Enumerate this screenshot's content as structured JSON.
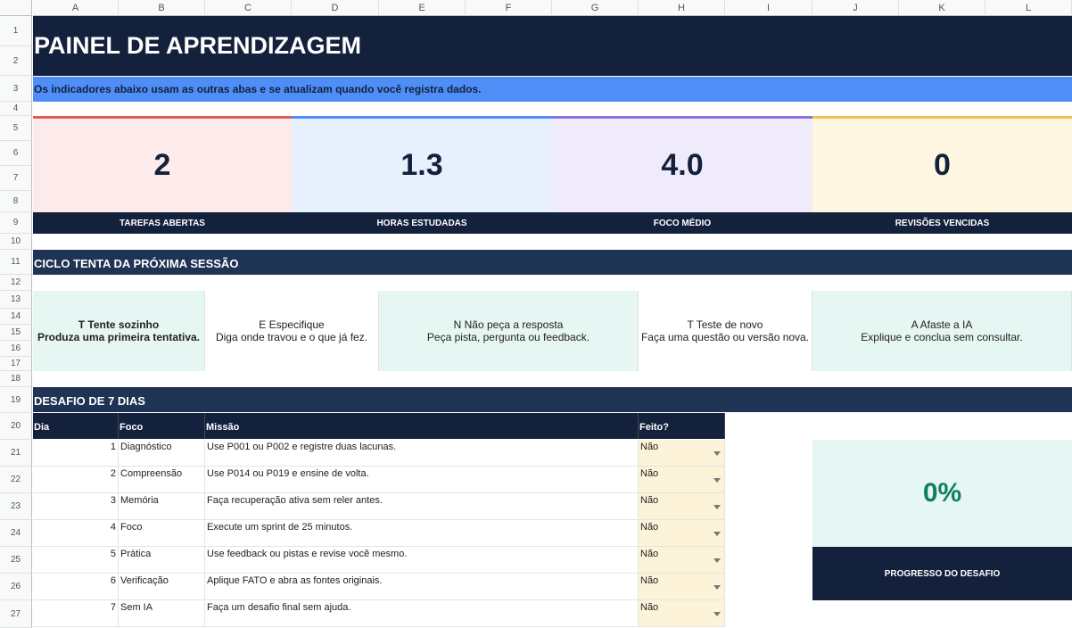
{
  "sheet": {
    "columns": [
      "A",
      "B",
      "C",
      "D",
      "E",
      "F",
      "G",
      "H",
      "I",
      "J",
      "K",
      "L"
    ],
    "rows": [
      "1",
      "2",
      "3",
      "4",
      "5",
      "6",
      "7",
      "8",
      "9",
      "10",
      "11",
      "12",
      "13",
      "14",
      "15",
      "16",
      "17",
      "18",
      "19",
      "20",
      "21",
      "22",
      "23",
      "24",
      "25",
      "26",
      "27"
    ]
  },
  "header": {
    "title": "PAINEL DE APRENDIZAGEM",
    "subtitle": "Os indicadores abaixo usam as outras abas e se atualizam quando você registra dados."
  },
  "kpis": [
    {
      "value": "2",
      "label": "TAREFAS ABERTAS",
      "bg": "#fdebeb",
      "accent": "#e05a5a"
    },
    {
      "value": "1.3",
      "label": "HORAS ESTUDADAS",
      "bg": "#e7f0fd",
      "accent": "#4f8ef7"
    },
    {
      "value": "4.0",
      "label": "FOCO MÉDIO",
      "bg": "#efebfb",
      "accent": "#8b72e0"
    },
    {
      "value": "0",
      "label": "REVISÕES VENCIDAS",
      "bg": "#fdf6e0",
      "accent": "#f2c14e"
    }
  ],
  "ciclo": {
    "title": "CICLO TENTA DA PRÓXIMA SESSÃO",
    "steps": [
      {
        "head": "T  Tente sozinho",
        "body": "Produza uma primeira tentativa.",
        "bg": "#e6f6f2",
        "bold": true
      },
      {
        "head": "E  Especifique",
        "body": "Diga onde travou e o que já fez.",
        "bg": "#ffffff",
        "bold": false
      },
      {
        "head": "N  Não peça a resposta",
        "body": "Peça pista, pergunta ou feedback.",
        "bg": "#e6f6f2",
        "bold": false
      },
      {
        "head": "T  Teste de novo",
        "body": "Faça uma questão ou versão nova.",
        "bg": "#ffffff",
        "bold": false
      },
      {
        "head": "A  Afaste a IA",
        "body": "Explique e conclua sem consultar.",
        "bg": "#e6f6f2",
        "bold": false
      }
    ]
  },
  "desafio": {
    "title": "DESAFIO DE 7 DIAS",
    "headers": {
      "dia": "Dia",
      "foco": "Foco",
      "missao": "Missão",
      "feito": "Feito?"
    },
    "rows": [
      {
        "dia": "1",
        "foco": "Diagnóstico",
        "missao": "Use P001 ou P002 e registre duas lacunas.",
        "feito": "Não"
      },
      {
        "dia": "2",
        "foco": "Compreensão",
        "missao": "Use P014 ou P019 e ensine de volta.",
        "feito": "Não"
      },
      {
        "dia": "3",
        "foco": "Memória",
        "missao": "Faça recuperação ativa sem reler antes.",
        "feito": "Não"
      },
      {
        "dia": "4",
        "foco": "Foco",
        "missao": "Execute um sprint de 25 minutos.",
        "feito": "Não"
      },
      {
        "dia": "5",
        "foco": "Prática",
        "missao": "Use feedback ou pistas e revise você mesmo.",
        "feito": "Não"
      },
      {
        "dia": "6",
        "foco": "Verificação",
        "missao": "Aplique FATO e abra as fontes originais.",
        "feito": "Não"
      },
      {
        "dia": "7",
        "foco": "Sem IA",
        "missao": "Faça um desafio final sem ajuda.",
        "feito": "Não"
      }
    ],
    "progress_value": "0%",
    "progress_label": "PROGRESSO DO DESAFIO"
  }
}
